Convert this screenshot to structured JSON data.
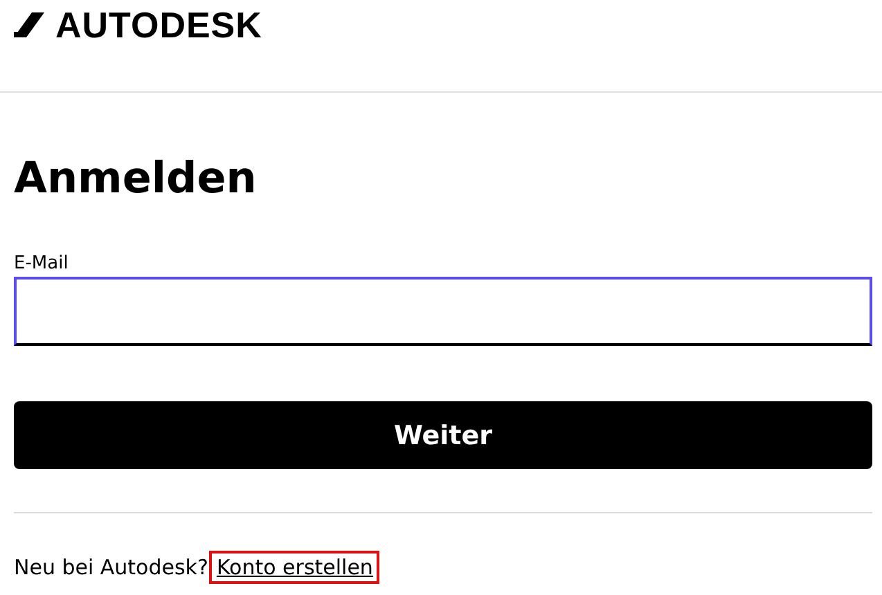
{
  "header": {
    "logo_text": "AUTODESK"
  },
  "heading": "Anmelden",
  "email_field": {
    "label": "E-Mail",
    "focused": true
  },
  "submit_button": "Weiter",
  "signup": {
    "prompt": "Neu bei Autodesk?",
    "link": "Konto erstellen",
    "highlighted": true
  }
}
